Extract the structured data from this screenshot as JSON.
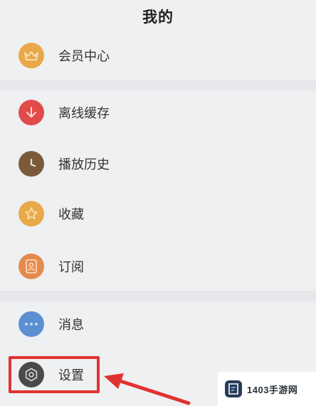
{
  "header": {
    "title": "我的"
  },
  "menu": {
    "vip": {
      "label": "会员中心",
      "icon": "crown-icon",
      "color": "#e9a84a"
    },
    "offline": {
      "label": "离线缓存",
      "icon": "download-icon",
      "color": "#e24a4a"
    },
    "history": {
      "label": "播放历史",
      "icon": "clock-icon",
      "color": "#7b5a3c"
    },
    "favorites": {
      "label": "收藏",
      "icon": "star-icon",
      "color": "#e8a94a"
    },
    "subscribe": {
      "label": "订阅",
      "icon": "person-icon",
      "color": "#e58a4d"
    },
    "messages": {
      "label": "消息",
      "icon": "dots-icon",
      "color": "#5b8fd1"
    },
    "settings": {
      "label": "设置",
      "icon": "gear-icon",
      "color": "#4a4a4a"
    }
  },
  "watermark": {
    "text": "1403手游网",
    "logo": "watermark-logo"
  },
  "annotation": {
    "color": "#e23131"
  }
}
